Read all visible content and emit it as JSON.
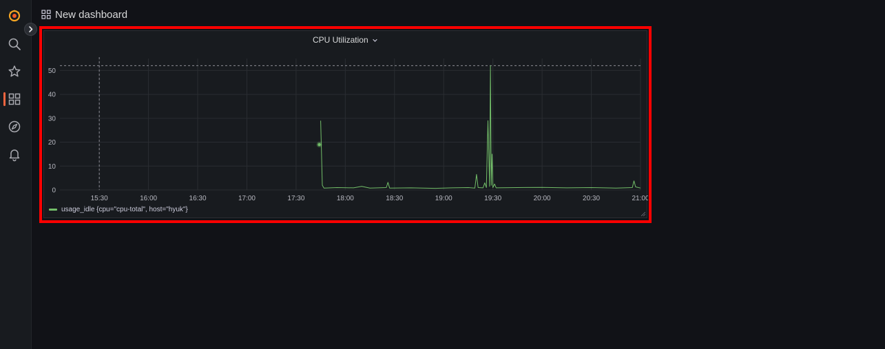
{
  "sidebar": {
    "icons": [
      "grafana-logo-icon",
      "search-icon",
      "star-icon",
      "dashboards-icon",
      "explore-icon",
      "alerting-bell-icon"
    ],
    "active": "dashboards-icon",
    "accent": "#f5653f"
  },
  "header": {
    "title": "New dashboard",
    "icon": "dashboard-grid-icon"
  },
  "panel": {
    "title": "CPU Utilization",
    "title_icon": "chevron-down-icon"
  },
  "chart_data": {
    "type": "line",
    "title": "CPU Utilization",
    "xlabel": "",
    "ylabel": "",
    "x_ticks": [
      "15:30",
      "16:00",
      "16:30",
      "17:00",
      "17:30",
      "18:00",
      "18:30",
      "19:00",
      "19:30",
      "20:00",
      "20:30",
      "21:00"
    ],
    "y_ticks": [
      0,
      10,
      20,
      30,
      40,
      50
    ],
    "xlim": [
      "15:06",
      "21:00"
    ],
    "ylim": [
      0,
      55
    ],
    "threshold_line": 52,
    "crosshair_x": "15:30",
    "grid": true,
    "legend_position": "bottom-left",
    "series": [
      {
        "name": "usage_idle {cpu=\"cpu-total\", host=\"hyuk\"}",
        "color": "#73bf69",
        "points": [
          [
            "17:45",
            29
          ],
          [
            "17:46",
            2
          ],
          [
            "17:47",
            0.8
          ],
          [
            "17:55",
            1.0
          ],
          [
            "18:05",
            0.9
          ],
          [
            "18:10",
            1.5
          ],
          [
            "18:15",
            0.8
          ],
          [
            "18:25",
            1.0
          ],
          [
            "18:26",
            3.2
          ],
          [
            "18:27",
            0.8
          ],
          [
            "18:40",
            0.9
          ],
          [
            "18:55",
            0.7
          ],
          [
            "19:05",
            0.9
          ],
          [
            "19:15",
            1.0
          ],
          [
            "19:19",
            0.8
          ],
          [
            "19:20",
            6.5
          ],
          [
            "19:21",
            1.0
          ],
          [
            "19:24",
            0.9
          ],
          [
            "19:25",
            3
          ],
          [
            "19:26",
            1.0
          ],
          [
            "19:27",
            29
          ],
          [
            "19:28",
            1.5
          ],
          [
            "19:28.5",
            52
          ],
          [
            "19:29",
            2
          ],
          [
            "19:29.5",
            15
          ],
          [
            "19:30",
            1.0
          ],
          [
            "19:31",
            2.5
          ],
          [
            "19:32",
            0.9
          ],
          [
            "19:45",
            1.0
          ],
          [
            "20:00",
            1.1
          ],
          [
            "20:15",
            0.9
          ],
          [
            "20:30",
            1.0
          ],
          [
            "20:45",
            0.8
          ],
          [
            "20:55",
            1.0
          ],
          [
            "20:56",
            3.8
          ],
          [
            "20:57",
            1.3
          ],
          [
            "21:00",
            0.8
          ]
        ]
      }
    ],
    "hover_point": {
      "x": "17:45",
      "y": 19
    }
  }
}
